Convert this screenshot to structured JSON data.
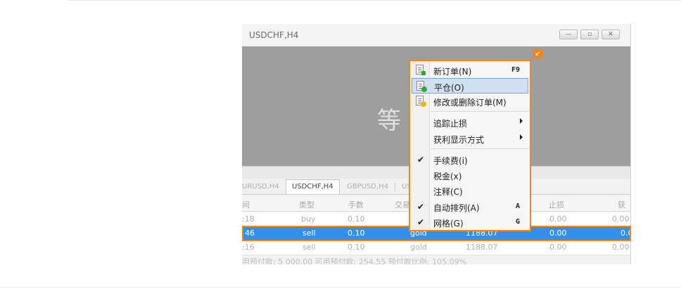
{
  "window": {
    "title": "USDCHF,H4",
    "watermark": "等 ⁄",
    "buttons": [
      "minimize",
      "maximize",
      "close"
    ]
  },
  "tabs": [
    {
      "label": "URUSD,H4",
      "active": false
    },
    {
      "label": "USDCHF,H4",
      "active": true
    },
    {
      "label": "GBPUSD,H4",
      "active": false
    },
    {
      "label": "US",
      "active": false
    }
  ],
  "table": {
    "headers": [
      "间",
      "类型",
      "手数",
      "交易",
      "",
      "止损",
      "获利"
    ],
    "rows": [
      {
        "time": ":18",
        "type": "buy",
        "lots": "0.10",
        "symbol": "",
        "price": "",
        "sl": "0.00",
        "tp": "0.00",
        "selected": false
      },
      {
        "time": "46",
        "type": "sell",
        "lots": "0.10",
        "symbol": "gold",
        "price": "1188.07",
        "sl": "0.00",
        "tp": "0.0",
        "selected": true
      },
      {
        "time": ":16",
        "type": "sell",
        "lots": "0.10",
        "symbol": "gold",
        "price": "1188.07",
        "sl": "0.00",
        "tp": "0.00",
        "selected": false
      }
    ],
    "status": "用预付款: 5 000.00  可用预付款: 254.55  预付款比例: 105.09%"
  },
  "context_menu": {
    "items": [
      {
        "label": "新订单(N)",
        "accel": "F9",
        "icon": "new-order-icon"
      },
      {
        "label": "平仓(O)",
        "icon": "close-position-icon",
        "highlighted": true
      },
      {
        "label": "修改或删除订单(M)",
        "icon": "modify-order-icon"
      },
      {
        "label": "追踪止损",
        "submenu": true
      },
      {
        "label": "获利显示方式",
        "submenu": true
      },
      {
        "label": "手续费(i)",
        "checked": true
      },
      {
        "label": "税金(x)"
      },
      {
        "label": "注释(C)"
      },
      {
        "label": "自动排列(A)",
        "accel": "A",
        "checked": true
      },
      {
        "label": "网格(G)",
        "accel": "G",
        "checked": true
      }
    ],
    "marker_icon": "arrow-down-left-icon"
  },
  "colors": {
    "accent": "#f0861e",
    "selection": "#3390e8"
  }
}
